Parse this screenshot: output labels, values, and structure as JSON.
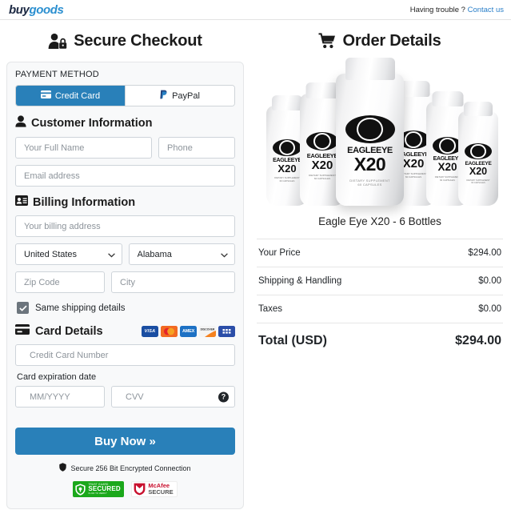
{
  "topbar": {
    "logo_buy": "buy",
    "logo_goods": "goods",
    "help_text": "Having trouble ?",
    "help_link": "Contact us"
  },
  "checkout": {
    "heading": "Secure Checkout",
    "payment_method_label": "PAYMENT METHOD",
    "tabs": [
      {
        "label": "Credit Card",
        "active": true
      },
      {
        "label": "PayPal",
        "active": false
      }
    ],
    "customer": {
      "heading": "Customer Information",
      "full_name_placeholder": "Your Full Name",
      "full_name_value": "",
      "phone_placeholder": "Phone",
      "phone_value": "",
      "email_placeholder": "Email address",
      "email_value": ""
    },
    "billing": {
      "heading": "Billing Information",
      "address_placeholder": "Your billing address",
      "address_value": "",
      "country_selected": "United States",
      "state_selected": "Alabama",
      "zip_placeholder": "Zip Code",
      "zip_value": "",
      "city_placeholder": "City",
      "city_value": "",
      "same_shipping_label": "Same shipping details",
      "same_shipping_checked": true
    },
    "card": {
      "heading": "Card Details",
      "brands": [
        "VISA",
        "Mastercard",
        "AMEX",
        "DISCOVER",
        "Generic Card"
      ],
      "number_placeholder": "Credit Card Number",
      "number_value": "",
      "expiration_label": "Card expiration date",
      "expiration_placeholder": "MM/YYYY",
      "expiration_value": "",
      "cvv_placeholder": "CVV",
      "cvv_value": ""
    },
    "buy_button": "Buy Now »",
    "secure_note": "Secure 256 Bit Encrypted Connection",
    "badges": [
      {
        "top": "TRUST GUARD",
        "mid": "SECURED",
        "bot": "CLICK TO VERIFY"
      },
      {
        "top": "McAfee",
        "bot": "SECURE"
      }
    ]
  },
  "order": {
    "heading": "Order Details",
    "product_name": "Eagle Eye X20 - 6 Bottles",
    "bottle_label": {
      "brand_line1": "EAGLEEYE",
      "brand_line2": "X20",
      "sub_line1": "DIETARY SUPPLEMENT",
      "sub_line2": "60 CAPSULES"
    },
    "lines": [
      {
        "label": "Your Price",
        "value": "$294.00"
      },
      {
        "label": "Shipping & Handling",
        "value": "$0.00"
      },
      {
        "label": "Taxes",
        "value": "$0.00"
      }
    ],
    "total": {
      "label": "Total (USD)",
      "value": "$294.00"
    }
  },
  "colors": {
    "accent": "#2980b9",
    "link": "#2a7fc9",
    "panel": "#f8f9fa",
    "checkbox": "#6c757d"
  }
}
